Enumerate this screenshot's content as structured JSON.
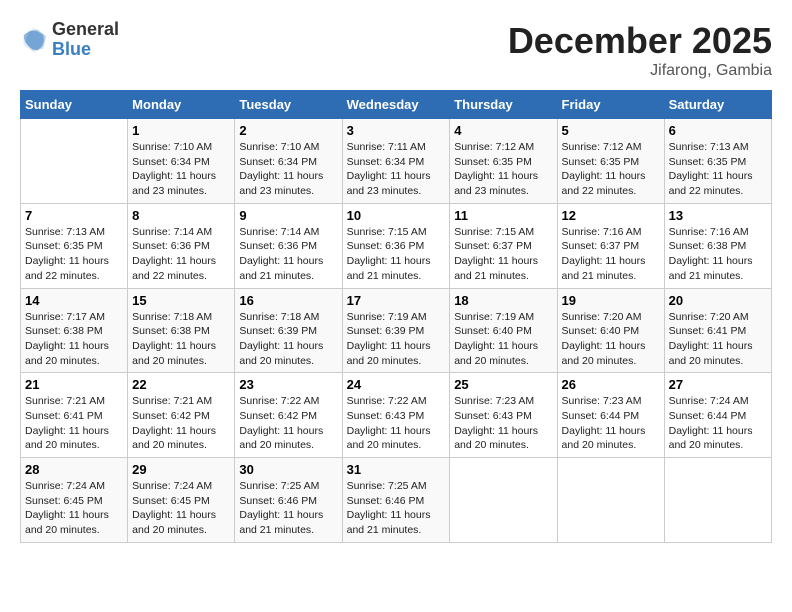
{
  "logo": {
    "general": "General",
    "blue": "Blue"
  },
  "title": "December 2025",
  "subtitle": "Jifarong, Gambia",
  "days_header": [
    "Sunday",
    "Monday",
    "Tuesday",
    "Wednesday",
    "Thursday",
    "Friday",
    "Saturday"
  ],
  "weeks": [
    [
      {
        "num": "",
        "info": ""
      },
      {
        "num": "1",
        "info": "Sunrise: 7:10 AM\nSunset: 6:34 PM\nDaylight: 11 hours\nand 23 minutes."
      },
      {
        "num": "2",
        "info": "Sunrise: 7:10 AM\nSunset: 6:34 PM\nDaylight: 11 hours\nand 23 minutes."
      },
      {
        "num": "3",
        "info": "Sunrise: 7:11 AM\nSunset: 6:34 PM\nDaylight: 11 hours\nand 23 minutes."
      },
      {
        "num": "4",
        "info": "Sunrise: 7:12 AM\nSunset: 6:35 PM\nDaylight: 11 hours\nand 23 minutes."
      },
      {
        "num": "5",
        "info": "Sunrise: 7:12 AM\nSunset: 6:35 PM\nDaylight: 11 hours\nand 22 minutes."
      },
      {
        "num": "6",
        "info": "Sunrise: 7:13 AM\nSunset: 6:35 PM\nDaylight: 11 hours\nand 22 minutes."
      }
    ],
    [
      {
        "num": "7",
        "info": "Sunrise: 7:13 AM\nSunset: 6:35 PM\nDaylight: 11 hours\nand 22 minutes."
      },
      {
        "num": "8",
        "info": "Sunrise: 7:14 AM\nSunset: 6:36 PM\nDaylight: 11 hours\nand 22 minutes."
      },
      {
        "num": "9",
        "info": "Sunrise: 7:14 AM\nSunset: 6:36 PM\nDaylight: 11 hours\nand 21 minutes."
      },
      {
        "num": "10",
        "info": "Sunrise: 7:15 AM\nSunset: 6:36 PM\nDaylight: 11 hours\nand 21 minutes."
      },
      {
        "num": "11",
        "info": "Sunrise: 7:15 AM\nSunset: 6:37 PM\nDaylight: 11 hours\nand 21 minutes."
      },
      {
        "num": "12",
        "info": "Sunrise: 7:16 AM\nSunset: 6:37 PM\nDaylight: 11 hours\nand 21 minutes."
      },
      {
        "num": "13",
        "info": "Sunrise: 7:16 AM\nSunset: 6:38 PM\nDaylight: 11 hours\nand 21 minutes."
      }
    ],
    [
      {
        "num": "14",
        "info": "Sunrise: 7:17 AM\nSunset: 6:38 PM\nDaylight: 11 hours\nand 20 minutes."
      },
      {
        "num": "15",
        "info": "Sunrise: 7:18 AM\nSunset: 6:38 PM\nDaylight: 11 hours\nand 20 minutes."
      },
      {
        "num": "16",
        "info": "Sunrise: 7:18 AM\nSunset: 6:39 PM\nDaylight: 11 hours\nand 20 minutes."
      },
      {
        "num": "17",
        "info": "Sunrise: 7:19 AM\nSunset: 6:39 PM\nDaylight: 11 hours\nand 20 minutes."
      },
      {
        "num": "18",
        "info": "Sunrise: 7:19 AM\nSunset: 6:40 PM\nDaylight: 11 hours\nand 20 minutes."
      },
      {
        "num": "19",
        "info": "Sunrise: 7:20 AM\nSunset: 6:40 PM\nDaylight: 11 hours\nand 20 minutes."
      },
      {
        "num": "20",
        "info": "Sunrise: 7:20 AM\nSunset: 6:41 PM\nDaylight: 11 hours\nand 20 minutes."
      }
    ],
    [
      {
        "num": "21",
        "info": "Sunrise: 7:21 AM\nSunset: 6:41 PM\nDaylight: 11 hours\nand 20 minutes."
      },
      {
        "num": "22",
        "info": "Sunrise: 7:21 AM\nSunset: 6:42 PM\nDaylight: 11 hours\nand 20 minutes."
      },
      {
        "num": "23",
        "info": "Sunrise: 7:22 AM\nSunset: 6:42 PM\nDaylight: 11 hours\nand 20 minutes."
      },
      {
        "num": "24",
        "info": "Sunrise: 7:22 AM\nSunset: 6:43 PM\nDaylight: 11 hours\nand 20 minutes."
      },
      {
        "num": "25",
        "info": "Sunrise: 7:23 AM\nSunset: 6:43 PM\nDaylight: 11 hours\nand 20 minutes."
      },
      {
        "num": "26",
        "info": "Sunrise: 7:23 AM\nSunset: 6:44 PM\nDaylight: 11 hours\nand 20 minutes."
      },
      {
        "num": "27",
        "info": "Sunrise: 7:24 AM\nSunset: 6:44 PM\nDaylight: 11 hours\nand 20 minutes."
      }
    ],
    [
      {
        "num": "28",
        "info": "Sunrise: 7:24 AM\nSunset: 6:45 PM\nDaylight: 11 hours\nand 20 minutes."
      },
      {
        "num": "29",
        "info": "Sunrise: 7:24 AM\nSunset: 6:45 PM\nDaylight: 11 hours\nand 20 minutes."
      },
      {
        "num": "30",
        "info": "Sunrise: 7:25 AM\nSunset: 6:46 PM\nDaylight: 11 hours\nand 21 minutes."
      },
      {
        "num": "31",
        "info": "Sunrise: 7:25 AM\nSunset: 6:46 PM\nDaylight: 11 hours\nand 21 minutes."
      },
      {
        "num": "",
        "info": ""
      },
      {
        "num": "",
        "info": ""
      },
      {
        "num": "",
        "info": ""
      }
    ]
  ]
}
